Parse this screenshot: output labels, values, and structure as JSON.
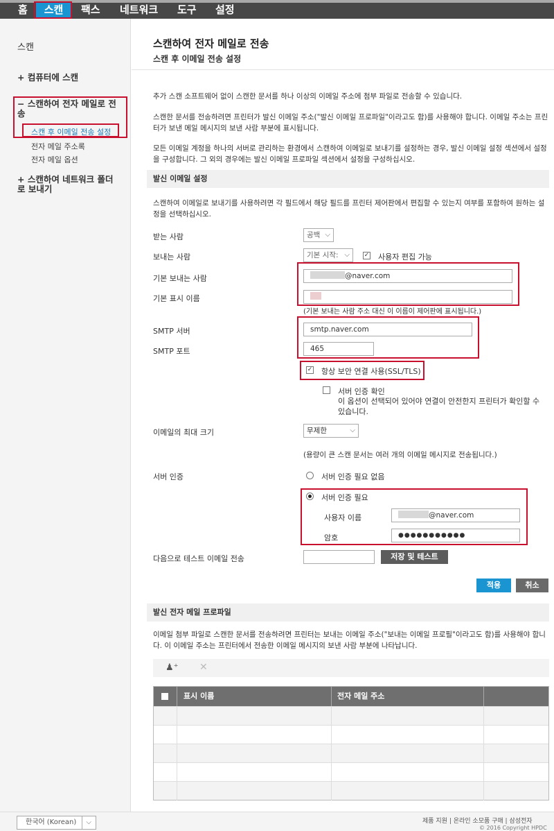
{
  "nav": {
    "tabs": [
      {
        "label": "홈"
      },
      {
        "label": "스캔"
      },
      {
        "label": "팩스"
      },
      {
        "label": "네트워크"
      },
      {
        "label": "도구"
      },
      {
        "label": "설정"
      }
    ]
  },
  "sidebar": {
    "title": "스캔",
    "groups": [
      {
        "label": "+ 컴퓨터에 스캔"
      },
      {
        "label": "− 스캔하여 전자 메일로 전송"
      },
      {
        "label": "+ 스캔하여 네트워크 폴더로 보내기"
      }
    ],
    "subitems": [
      {
        "label": "스캔 후 이메일 전송 설정"
      },
      {
        "label": "전자 메일 주소록"
      },
      {
        "label": "전자 메일 옵션"
      }
    ]
  },
  "main": {
    "title": "스캔하여 전자 메일로 전송",
    "subtitle": "스캔 후 이메일 전송 설정",
    "intro": [
      "추가 스캔 소프트웨어 없이 스캔한 문서를 하나 이상의 이메일 주소에 첨부 파일로 전송할 수 있습니다.",
      "스캔한 문서를 전송하려면 프린터가 발신 이메일 주소(\"발신 이메일 프로파일\"이라고도 함)를 사용해야 합니다. 이메일 주소는 프린터가 보낸 메일 메시지의 보낸 사람 부분에 표시됩니다.",
      "모든 이메일 계정을 하나의 서버로 관리하는 환경에서 스캔하여 이메일로 보내기를 설정하는 경우, 발신 이메일 설정 섹션에서 설정을 구성합니다. 그 외의 경우에는 발신 이메일 프로파일 섹션에서 설정을 구성하십시오."
    ],
    "outgoing": {
      "heading": "발신 이메일 설정",
      "description": "스캔하여 이메일로 보내기를 사용하려면 각 필드에서 해당 필드를 프린터 제어판에서 편집할 수 있는지 여부를 포함하여 원하는 설정을 선택하십시오.",
      "to_label": "받는 사람",
      "to_value": "공백",
      "from_label": "보내는 사람",
      "from_value": "기본 시작:",
      "user_editable_label": "사용자 편집 가능",
      "default_from_label": "기본 보내는 사람",
      "default_from_value": "@naver.com",
      "display_name_label": "기본 표시 이름",
      "display_name_hint": "(기본 보내는 사람 주소 대신 이 이름이 제어판에 표시됩니다.)",
      "smtp_server_label": "SMTP 서버",
      "smtp_server_value": "smtp.naver.com",
      "smtp_port_label": "SMTP 포트",
      "smtp_port_value": "465",
      "ssl_label": "항상 보안 연결 사용(SSL/TLS)",
      "verify_label": "서버 인증 확인",
      "verify_hint": "이 옵션이 선택되어 있어야 연결이 안전한지 프린터가 확인할 수 있습니다.",
      "max_size_label": "이메일의 최대 크기",
      "max_size_value": "무제한",
      "max_size_hint": "(용량이 큰 스캔 문서는 여러 개의 이메일 메시지로 전송됩니다.)",
      "auth_label": "서버 인증",
      "auth_none_label": "서버 인증 필요 없음",
      "auth_required_label": "서버 인증 필요",
      "username_label": "사용자 이름",
      "username_value": "@naver.com",
      "password_label": "암호",
      "password_value": "●●●●●●●●●●●",
      "test_label": "다음으로 테스트 이메일 전송",
      "test_value": "",
      "save_test_button": "저장 및 테스트",
      "apply_button": "적용",
      "cancel_button": "취소"
    },
    "profiles": {
      "heading": "발신 전자 메일 프로파일",
      "description": "이메일 첨부 파일로 스캔한 문서를 전송하려면 프린터는 보내는 이메일 주소(\"보내는 이메일 프로필\"이라고도 함)를 사용해야 합니다. 이 이메일 주소는 프린터에서 전송한 이메일 메시지의 보낸 사람 부분에 나타납니다.",
      "columns": [
        "표시 이름",
        "전자 메일 주소"
      ],
      "row_count": 5
    }
  },
  "footer": {
    "language": "한국어 (Korean)",
    "links": "제품 지원 | 온라인 소모품 구매 | 삼성전자",
    "copyright": "© 2016 Copyright HPDC"
  },
  "colors": {
    "accent": "#1a95d1",
    "highlight": "#c8102e",
    "nav_bg": "#474747"
  }
}
